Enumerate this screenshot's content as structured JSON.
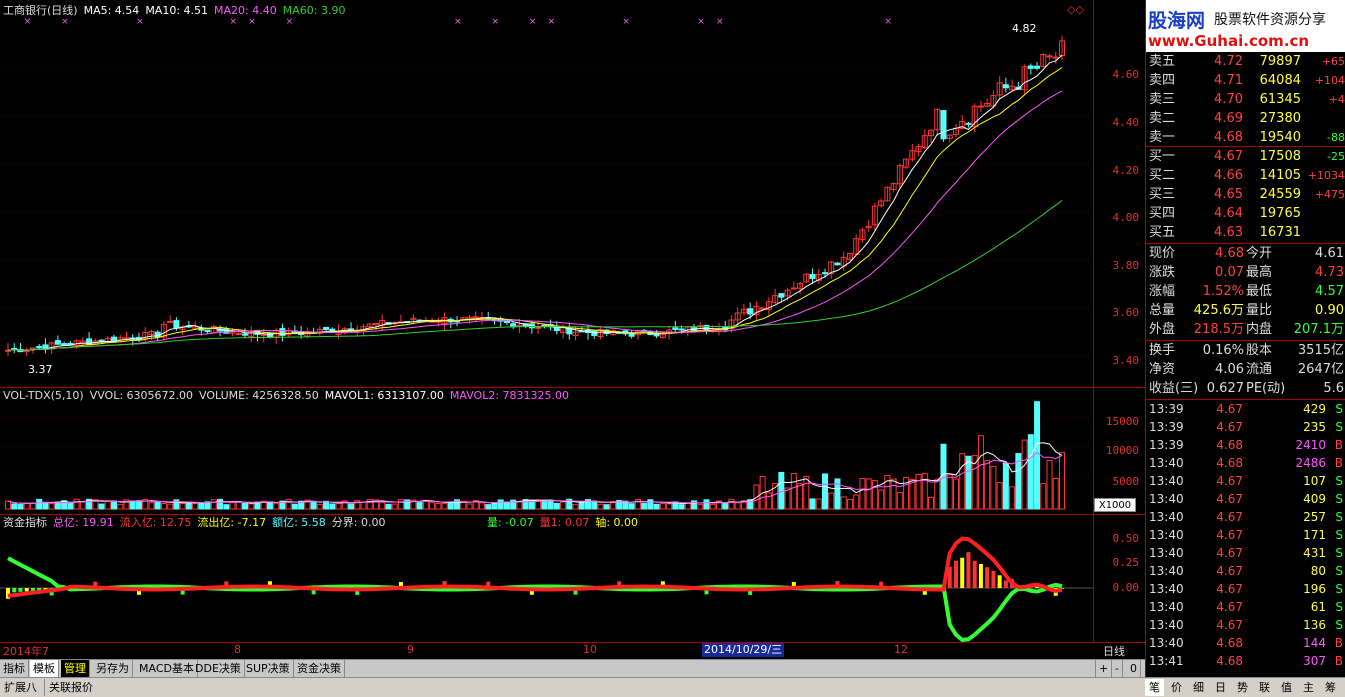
{
  "header": {
    "stock": "工商银行(日线)",
    "ma5": "MA5: 4.54",
    "ma10": "MA10: 4.51",
    "ma20": "MA20: 4.40",
    "ma60": "MA60: 3.90"
  },
  "price_axis": {
    "ticks": [
      "4.60",
      "4.40",
      "4.20",
      "4.00",
      "3.80",
      "3.60",
      "3.40"
    ],
    "values": [
      4.6,
      4.4,
      4.2,
      4.0,
      3.8,
      3.6,
      3.4
    ]
  },
  "price_annotations": {
    "high": "4.82",
    "low": "3.37"
  },
  "vol_header": {
    "name": "VOL-TDX(5,10)",
    "vvol": "VVOL: 6305672.00",
    "volume": "VOLUME: 4256328.50",
    "mavol1": "MAVOL1: 6313107.00",
    "mavol2": "MAVOL2: 7831325.00"
  },
  "vol_axis": {
    "ticks": [
      "15000",
      "10000",
      "5000"
    ],
    "values": [
      15000,
      10000,
      5000
    ],
    "unit": "X1000"
  },
  "fund_header": {
    "name": "资金指标",
    "total": "总亿: 19.91",
    "inflow": "流入亿: 12.75",
    "outflow": "流出亿: -7.17",
    "amount": "额亿: 5.58",
    "divider": "分界: 0.00",
    "liang": "量: -0.07",
    "liang1": "量1: 0.07",
    "axis": "轴: 0.00"
  },
  "fund_axis": {
    "ticks": [
      "0.50",
      "0.25",
      "0.00"
    ],
    "values": [
      0.5,
      0.25,
      0
    ]
  },
  "x_axis": {
    "labels": [
      "2014年7",
      "8",
      "9",
      "10",
      "12"
    ],
    "cursor_date": "2014/10/29/三",
    "period": "日线"
  },
  "logo": {
    "name": "股海网",
    "slogan": "股票软件资源分享",
    "url": "www.Guhai.com.cn"
  },
  "order_book": [
    {
      "label": "卖五",
      "price": "4.72",
      "vol": "79897",
      "chg": "+65"
    },
    {
      "label": "卖四",
      "price": "4.71",
      "vol": "64084",
      "chg": "+104"
    },
    {
      "label": "卖三",
      "price": "4.70",
      "vol": "61345",
      "chg": "+4"
    },
    {
      "label": "卖二",
      "price": "4.69",
      "vol": "27380",
      "chg": ""
    },
    {
      "label": "卖一",
      "price": "4.68",
      "vol": "19540",
      "chg": "-88"
    },
    {
      "label": "买一",
      "price": "4.67",
      "vol": "17508",
      "chg": "-25"
    },
    {
      "label": "买二",
      "price": "4.66",
      "vol": "14105",
      "chg": "+1034"
    },
    {
      "label": "买三",
      "price": "4.65",
      "vol": "24559",
      "chg": "+475"
    },
    {
      "label": "买四",
      "price": "4.64",
      "vol": "19765",
      "chg": ""
    },
    {
      "label": "买五",
      "price": "4.63",
      "vol": "16731",
      "chg": ""
    }
  ],
  "quote": [
    {
      "l1": "现价",
      "v1": "4.68",
      "l2": "今开",
      "v2": "4.61"
    },
    {
      "l1": "涨跌",
      "v1": "0.07",
      "l2": "最高",
      "v2": "4.73"
    },
    {
      "l1": "涨幅",
      "v1": "1.52%",
      "l2": "最低",
      "v2": "4.57"
    },
    {
      "l1": "总量",
      "v1": "425.6万",
      "l2": "量比",
      "v2": "0.90"
    },
    {
      "l1": "外盘",
      "v1": "218.5万",
      "l2": "内盘",
      "v2": "207.1万"
    }
  ],
  "fundamentals": [
    {
      "l1": "换手",
      "v1": "0.16%",
      "l2": "股本",
      "v2": "3515亿"
    },
    {
      "l1": "净资",
      "v1": "4.06",
      "l2": "流通",
      "v2": "2647亿"
    },
    {
      "l1": "收益(三)",
      "v1": "0.627",
      "l2": "PE(动)",
      "v2": "5.6"
    }
  ],
  "ticks": [
    {
      "t": "13:39",
      "p": "4.67",
      "v": "429",
      "s": "S"
    },
    {
      "t": "13:39",
      "p": "4.67",
      "v": "235",
      "s": "S"
    },
    {
      "t": "13:39",
      "p": "4.68",
      "v": "2410",
      "s": "B"
    },
    {
      "t": "13:40",
      "p": "4.68",
      "v": "2486",
      "s": "B"
    },
    {
      "t": "13:40",
      "p": "4.67",
      "v": "107",
      "s": "S"
    },
    {
      "t": "13:40",
      "p": "4.67",
      "v": "409",
      "s": "S"
    },
    {
      "t": "13:40",
      "p": "4.67",
      "v": "257",
      "s": "S"
    },
    {
      "t": "13:40",
      "p": "4.67",
      "v": "171",
      "s": "S"
    },
    {
      "t": "13:40",
      "p": "4.67",
      "v": "431",
      "s": "S"
    },
    {
      "t": "13:40",
      "p": "4.67",
      "v": "80",
      "s": "S"
    },
    {
      "t": "13:40",
      "p": "4.67",
      "v": "196",
      "s": "S"
    },
    {
      "t": "13:40",
      "p": "4.67",
      "v": "61",
      "s": "S"
    },
    {
      "t": "13:40",
      "p": "4.67",
      "v": "136",
      "s": "S"
    },
    {
      "t": "13:40",
      "p": "4.68",
      "v": "144",
      "s": "B"
    },
    {
      "t": "13:41",
      "p": "4.68",
      "v": "307",
      "s": "B"
    }
  ],
  "tabs": [
    "指标",
    "模板",
    "管理",
    "另存为",
    "MACD基本",
    "DDE决策",
    "SUP决策",
    "资金决策"
  ],
  "controls": {
    "plus": "+",
    "minus": "-",
    "zero": "0"
  },
  "bottom_tabs": [
    "扩展八",
    "关联报价"
  ],
  "right_tabs": [
    "笔",
    "价",
    "细",
    "日",
    "势",
    "联",
    "值",
    "主",
    "筹"
  ],
  "colors": {
    "up": "#ff3333",
    "down": "#54ffff",
    "ma5": "#ffffff",
    "ma10": "#ffff00",
    "ma20": "#ff55ff",
    "ma60": "#33cc33",
    "grid": "#aa0000"
  }
}
